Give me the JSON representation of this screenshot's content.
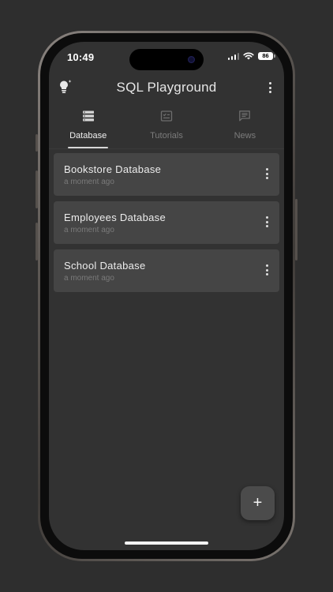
{
  "status_bar": {
    "time": "10:49",
    "battery": "86"
  },
  "header": {
    "title": "SQL Playground",
    "left_icon": "lightbulb-icon",
    "right_icon": "more-vert-icon"
  },
  "tabs": [
    {
      "label": "Database",
      "icon": "database-icon",
      "active": true
    },
    {
      "label": "Tutorials",
      "icon": "tutorials-icon",
      "active": false
    },
    {
      "label": "News",
      "icon": "news-icon",
      "active": false
    }
  ],
  "databases": [
    {
      "name": "Bookstore Database",
      "updated": "a moment ago"
    },
    {
      "name": "Employees Database",
      "updated": "a moment ago"
    },
    {
      "name": "School Database",
      "updated": "a moment ago"
    }
  ],
  "fab": {
    "label": "+",
    "icon": "plus-icon"
  },
  "colors": {
    "background": "#323232",
    "card": "#454545",
    "text_primary": "#ececec",
    "text_secondary": "#7a7a7a"
  }
}
